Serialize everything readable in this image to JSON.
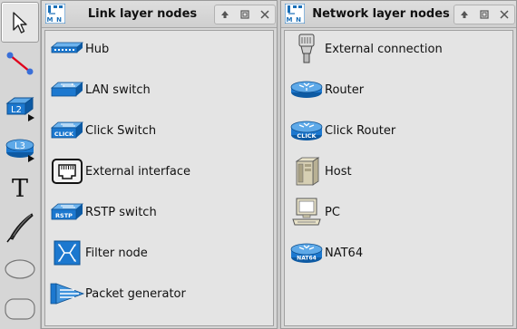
{
  "toolbar": {
    "tools": [
      {
        "name": "select-tool",
        "icon": "pointer-icon"
      },
      {
        "name": "link-tool",
        "icon": "link-line-icon"
      },
      {
        "name": "l2-node-tool",
        "icon": "l2-switch-icon",
        "label": "L2"
      },
      {
        "name": "l3-node-tool",
        "icon": "l3-router-icon",
        "label": "L3"
      },
      {
        "name": "text-tool",
        "icon": "text-icon",
        "label": "T"
      },
      {
        "name": "draw-tool",
        "icon": "pen-icon"
      },
      {
        "name": "oval-tool",
        "icon": "oval-icon"
      },
      {
        "name": "rounded-rect-tool",
        "icon": "rounded-rect-icon"
      }
    ]
  },
  "link_panel": {
    "title": "Link layer nodes",
    "logo_letters": [
      "I",
      "M",
      "N"
    ],
    "items": [
      {
        "label": "Hub",
        "icon": "hub-icon"
      },
      {
        "label": "LAN switch",
        "icon": "lan-switch-icon"
      },
      {
        "label": "Click Switch",
        "icon": "click-switch-icon",
        "icon_text": "CLICK"
      },
      {
        "label": "External interface",
        "icon": "ethernet-port-icon"
      },
      {
        "label": "RSTP switch",
        "icon": "rstp-switch-icon",
        "icon_text": "RSTP"
      },
      {
        "label": "Filter node",
        "icon": "filter-node-icon"
      },
      {
        "label": "Packet generator",
        "icon": "packet-generator-icon"
      }
    ]
  },
  "network_panel": {
    "title": "Network layer nodes",
    "logo_letters": [
      "I",
      "M",
      "N"
    ],
    "items": [
      {
        "label": "External connection",
        "icon": "external-connection-icon"
      },
      {
        "label": "Router",
        "icon": "router-icon"
      },
      {
        "label": "Click Router",
        "icon": "click-router-icon",
        "icon_text": "CLICK"
      },
      {
        "label": "Host",
        "icon": "host-server-icon"
      },
      {
        "label": "PC",
        "icon": "pc-icon"
      },
      {
        "label": "NAT64",
        "icon": "nat64-router-icon",
        "icon_text": "NAT64"
      }
    ]
  },
  "colors": {
    "accent_blue": "#1a6fb8",
    "router_blue": "#1f74c4",
    "link_red": "#e0001b"
  }
}
